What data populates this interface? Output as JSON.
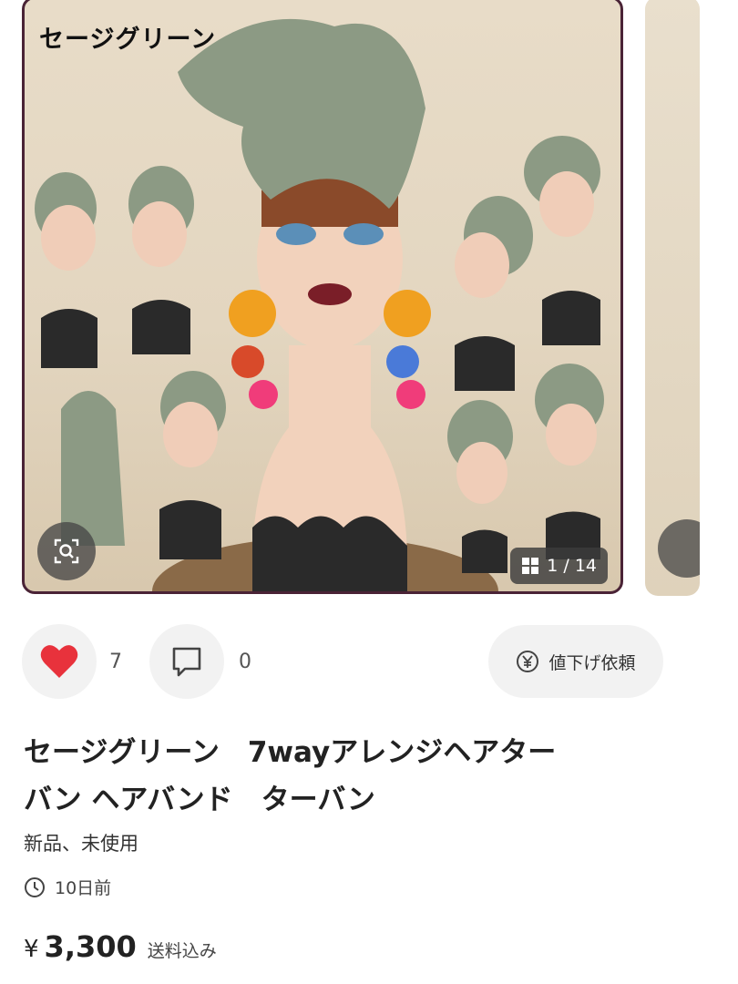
{
  "carousel": {
    "overlay_title": "セージグリーン",
    "counter": "1 / 14"
  },
  "actions": {
    "like_count": "7",
    "comment_count": "0",
    "price_request_label": "値下げ依頼"
  },
  "item": {
    "title_line1": "セージグリーン　7wayアレンジヘアター",
    "title_line2": "バン ヘアバンド　ターバン",
    "condition": "新品、未使用",
    "posted": "10日前",
    "currency": "¥",
    "price": "3,300",
    "shipping": "送料込み"
  },
  "colors": {
    "heart": "#e8323c",
    "frame": "#4a2336",
    "turban": "#8c9a84"
  }
}
